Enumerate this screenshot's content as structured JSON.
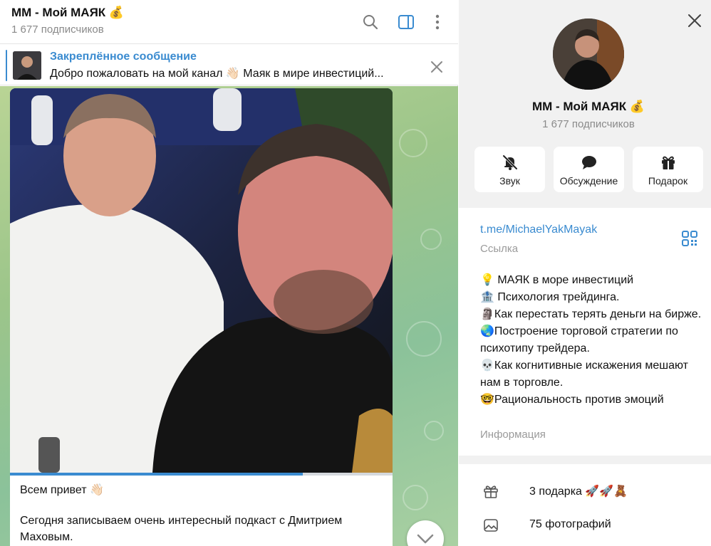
{
  "chat": {
    "title": "ММ - Мой МАЯК 💰",
    "subscribers": "1 677 подписчиков",
    "header_icons": [
      "search-icon",
      "sidebar-toggle-icon",
      "more-vertical-icon"
    ]
  },
  "pinned": {
    "title": "Закреплённое сообщение",
    "text": "Добро пожаловать на мой канал 👋🏻 Маяк в мире инвестиций..."
  },
  "message": {
    "line1": "Всем привет 👋🏻",
    "line2": "Сегодня записываем очень интересный подкаст с Дмитрием Маховым.",
    "video_progress": 0.765
  },
  "info": {
    "title": "ММ - Мой МАЯК 💰",
    "subscribers": "1 677 подписчиков",
    "actions": [
      {
        "label": "Звук",
        "icon": "bell-off-icon"
      },
      {
        "label": "Обсуждение",
        "icon": "chat-bubble-icon"
      },
      {
        "label": "Подарок",
        "icon": "gift-icon"
      }
    ],
    "link": "t.me/MichaelYakMayak",
    "link_caption": "Ссылка",
    "about_lines": [
      "💡 МАЯК  в море инвестиций",
      "🏦 Психология трейдинга.",
      "🗿Как перестать терять деньги на бирже.",
      "🌏Построение торговой стратегии по психотипу трейдера.",
      "💀Как когнитивные искажения мешают нам в торговле.",
      "🤓Рациональность против эмоций"
    ],
    "about_caption": "Информация",
    "gifts": "3 подарка 🚀🚀🧸",
    "photos": "75 фотографий"
  },
  "colors": {
    "accent": "#3a8bd0",
    "panel_bg": "#f1f1f1",
    "wallpaper": "#9cc58a"
  }
}
